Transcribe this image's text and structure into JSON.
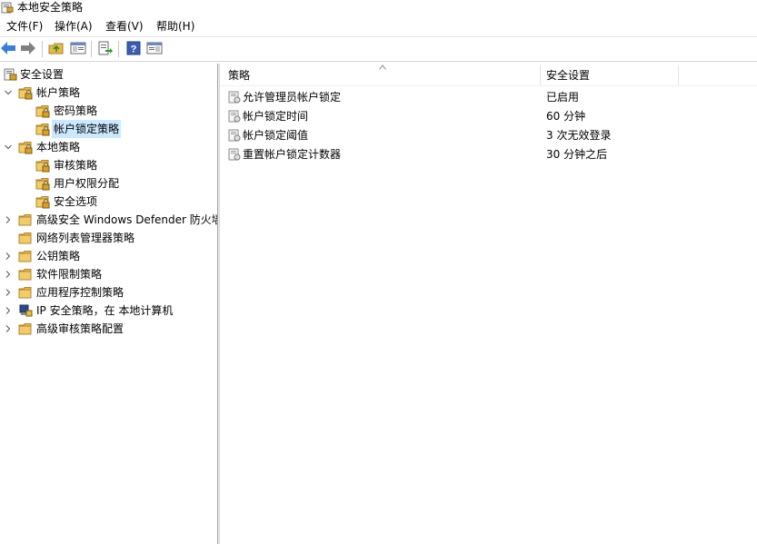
{
  "window": {
    "title": "本地安全策略"
  },
  "menu": [
    "文件(F)",
    "操作(A)",
    "查看(V)",
    "帮助(H)"
  ],
  "toolbar": {
    "icons": [
      "back-arrow-icon",
      "forward-arrow-icon",
      "up-folder-icon",
      "show-hide-tree-icon",
      "export-list-icon",
      "help-icon",
      "properties-icon"
    ]
  },
  "tree": {
    "root": "安全设置",
    "items": [
      {
        "label": "帐户策略",
        "expanded": true
      },
      {
        "label": "密码策略"
      },
      {
        "label": "帐户锁定策略",
        "selected": true
      },
      {
        "label": "本地策略",
        "expanded": true
      },
      {
        "label": "审核策略"
      },
      {
        "label": "用户权限分配"
      },
      {
        "label": "安全选项"
      },
      {
        "label": "高级安全 Windows Defender 防火墙",
        "expanded": false
      },
      {
        "label": "网络列表管理器策略"
      },
      {
        "label": "公钥策略",
        "expanded": false
      },
      {
        "label": "软件限制策略",
        "expanded": false
      },
      {
        "label": "应用程序控制策略",
        "expanded": false
      },
      {
        "label": "IP 安全策略，在 本地计算机",
        "expanded": false
      },
      {
        "label": "高级审核策略配置",
        "expanded": false
      }
    ]
  },
  "list": {
    "columns": [
      "策略",
      "安全设置"
    ],
    "rows": [
      {
        "policy": "允许管理员帐户锁定",
        "setting": "已启用"
      },
      {
        "policy": "帐户锁定时间",
        "setting": "60 分钟"
      },
      {
        "policy": "帐户锁定阈值",
        "setting": "3 次无效登录"
      },
      {
        "policy": "重置帐户锁定计数器",
        "setting": "30 分钟之后"
      }
    ]
  },
  "colors": {
    "selection": "#cce8ff",
    "folder": "#e8b84a",
    "lock": "#c89b2c",
    "nav_arrow": "#3b7ed6"
  }
}
